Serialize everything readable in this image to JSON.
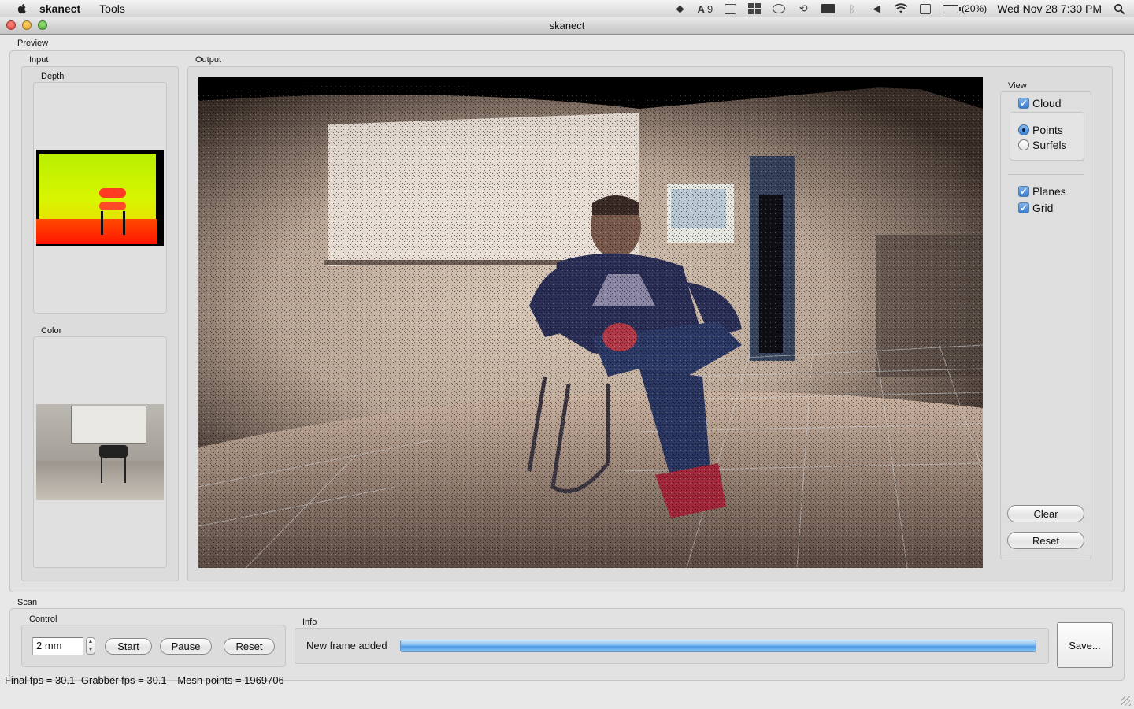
{
  "menubar": {
    "app_name": "skanect",
    "menus": [
      "Tools"
    ],
    "status_icons": [
      "dropbox-icon",
      "adobe-icon",
      "grid-icon",
      "spaces-icon",
      "chat-icon",
      "time-machine-icon",
      "display-icon",
      "bluetooth-icon",
      "volume-icon",
      "wifi-icon",
      "keyboard-icon",
      "battery-icon",
      "spotlight-icon"
    ],
    "adobe_count": "9",
    "battery_pct": "(20%)",
    "clock": "Wed Nov 28  7:30 PM"
  },
  "window": {
    "title": "skanect"
  },
  "preview": {
    "label": "Preview",
    "input_label": "Input",
    "depth_label": "Depth",
    "color_label": "Color",
    "output_label": "Output"
  },
  "view": {
    "label": "View",
    "cloud": {
      "label": "Cloud",
      "checked": true
    },
    "points": {
      "label": "Points",
      "selected": true
    },
    "surfels": {
      "label": "Surfels",
      "selected": false
    },
    "planes": {
      "label": "Planes",
      "checked": true
    },
    "grid": {
      "label": "Grid",
      "checked": true
    },
    "clear_label": "Clear",
    "reset_label": "Reset"
  },
  "scan": {
    "label": "Scan",
    "control_label": "Control",
    "resolution_value": "2 mm",
    "start_label": "Start",
    "pause_label": "Pause",
    "reset_label": "Reset",
    "info_label": "Info",
    "info_text": "New frame added",
    "progress": 1.0,
    "save_label": "Save..."
  },
  "status": {
    "final_fps": "Final fps = 30.1",
    "grabber_fps": "Grabber fps = 30.1",
    "mesh_points": "Mesh points = 1969706"
  },
  "colors": {
    "accent": "#3d7fd0",
    "progress": "#4d9be6"
  }
}
